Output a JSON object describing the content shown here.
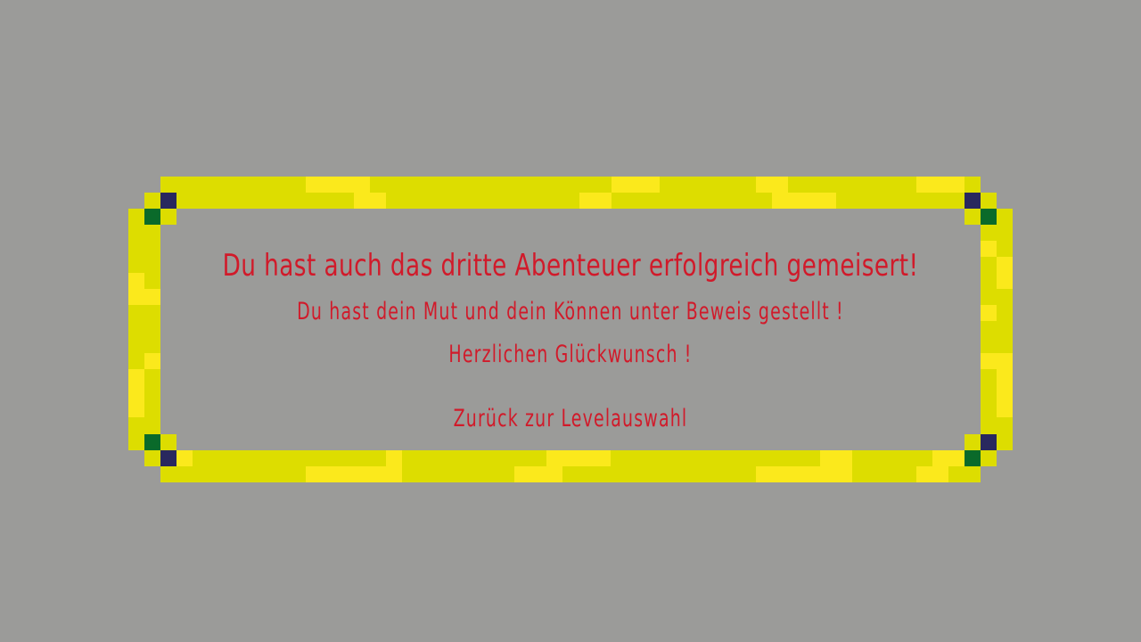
{
  "screen": {
    "background_color": "#9b9b99",
    "frame_colors": {
      "gold": "#dddd00",
      "light_gold": "#fbe91c",
      "corner_dark": "#29285e",
      "corner_green": "#0a6a2a"
    },
    "text_color": "#d11a2a"
  },
  "dialog": {
    "title": "Du hast auch das dritte Abenteuer erfolgreich gemeisert!",
    "subtitle": "Du hast dein Mut und dein Können unter Beweis gestellt !",
    "congrats": "Herzlichen Glückwunsch !",
    "back_label": "Zurück zur Levelauswahl"
  }
}
